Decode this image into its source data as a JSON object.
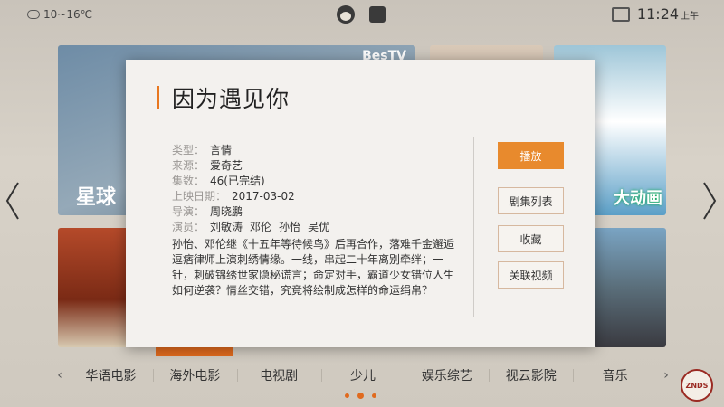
{
  "status": {
    "temperature": "10~16℃",
    "time": "11:24",
    "ampm": "上午"
  },
  "tiles": {
    "banner_label": "星球",
    "banner_logo": "BesTV",
    "right_label": "大动画"
  },
  "dialog": {
    "title": "因为遇见你",
    "info": [
      {
        "key": "类型：",
        "value": "言情"
      },
      {
        "key": "来源：",
        "value": "爱奇艺"
      },
      {
        "key": "集数：",
        "value": "46(已完结)"
      },
      {
        "key": "上映日期：",
        "value": "2017-03-02"
      },
      {
        "key": "导演：",
        "value": "周晓鹏"
      }
    ],
    "actors_key": "演员：",
    "actors": [
      "刘敏涛",
      "邓伦",
      "孙怡",
      "吴优"
    ],
    "description": "孙怡、邓伦继《十五年等待候鸟》后再合作，落难千金邂逅逗痞律师上演刺绣情缘。一线，串起二十年离别牵绊；一针，刺破锦绣世家隐秘谎言；命定对手，霸道少女错位人生如何逆袭？情丝交错，究竟将绘制成怎样的命运绢帛？",
    "buttons": {
      "play": "播放",
      "episodes": "剧集列表",
      "favorite": "收藏",
      "related": "关联视频"
    }
  },
  "categories": [
    "华语电影",
    "海外电影",
    "电视剧",
    "少儿",
    "娱乐综艺",
    "视云影院",
    "音乐"
  ],
  "nav": {
    "prev": "‹",
    "next": "›"
  },
  "badge": "ZNDS",
  "colors": {
    "accent": "#e88a2d",
    "title_bar": "#e8771f"
  }
}
